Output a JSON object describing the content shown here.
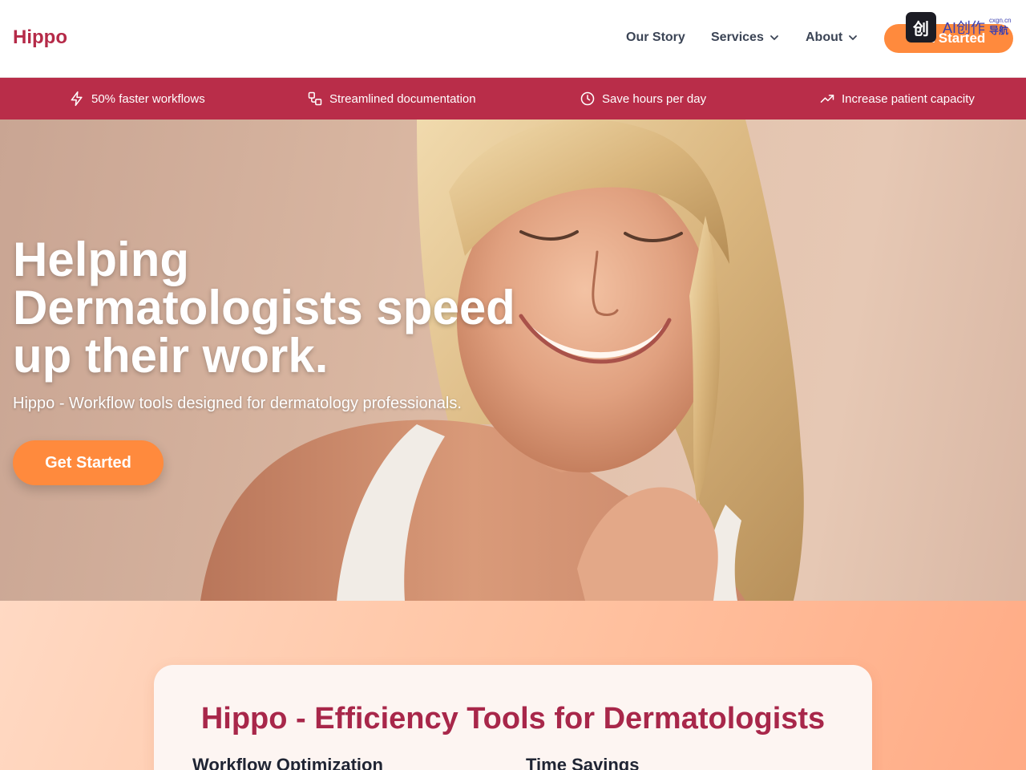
{
  "header": {
    "logo": "Hippo",
    "nav": [
      {
        "label": "Our Story",
        "has_dropdown": false
      },
      {
        "label": "Services",
        "has_dropdown": true
      },
      {
        "label": "About",
        "has_dropdown": true
      }
    ],
    "cta_label": "Get Started"
  },
  "watermark": {
    "glyph": "创",
    "text": "AI创作",
    "small": "cxgn.cn",
    "nav": "导航"
  },
  "benefits": [
    {
      "icon": "lightning-icon",
      "label": "50% faster workflows"
    },
    {
      "icon": "workflow-icon",
      "label": "Streamlined documentation"
    },
    {
      "icon": "clock-icon",
      "label": "Save hours per day"
    },
    {
      "icon": "trending-up-icon",
      "label": "Increase patient capacity"
    }
  ],
  "hero": {
    "title_lines": [
      "Helping",
      "Dermatologists speed",
      "up their work."
    ],
    "subtitle": "Hippo - Workflow tools designed for dermatology professionals.",
    "cta_label": "Get Started"
  },
  "features": {
    "title": "Hippo - Efficiency Tools for Dermatologists",
    "columns": [
      {
        "title": "Workflow Optimization"
      },
      {
        "title": "Time Savings"
      }
    ]
  },
  "colors": {
    "brand": "#b52a48",
    "benefit_bar": "#b92d49",
    "accent": "#ff8a3d",
    "nav_text": "#3b4455"
  }
}
